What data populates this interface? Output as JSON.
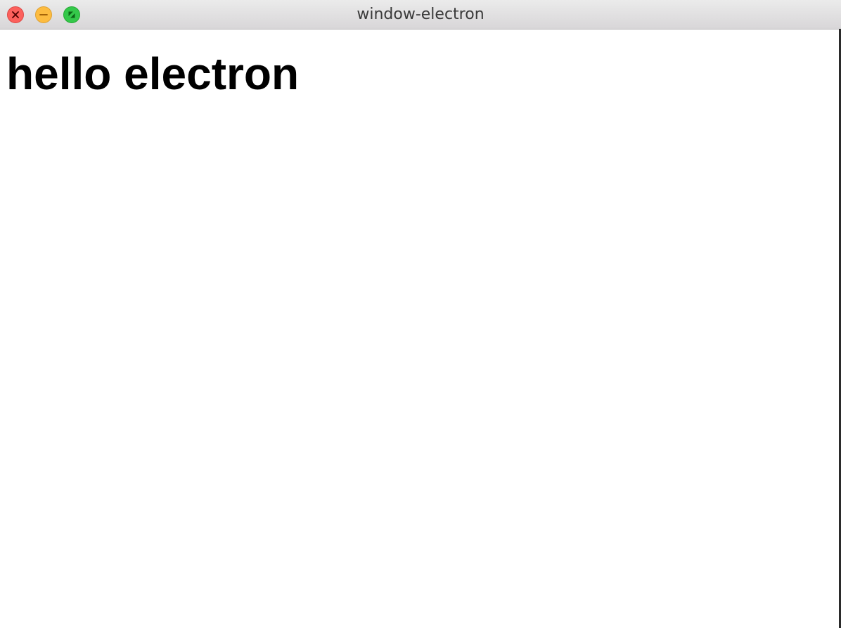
{
  "window": {
    "title": "window-electron"
  },
  "traffic_lights": {
    "close_color": "#fc605c",
    "minimize_color": "#fdbc40",
    "maximize_color": "#34c84a",
    "close_icon": "close-icon",
    "minimize_icon": "minimize-icon",
    "maximize_icon": "fullscreen-icon"
  },
  "main": {
    "heading": "hello electron"
  }
}
